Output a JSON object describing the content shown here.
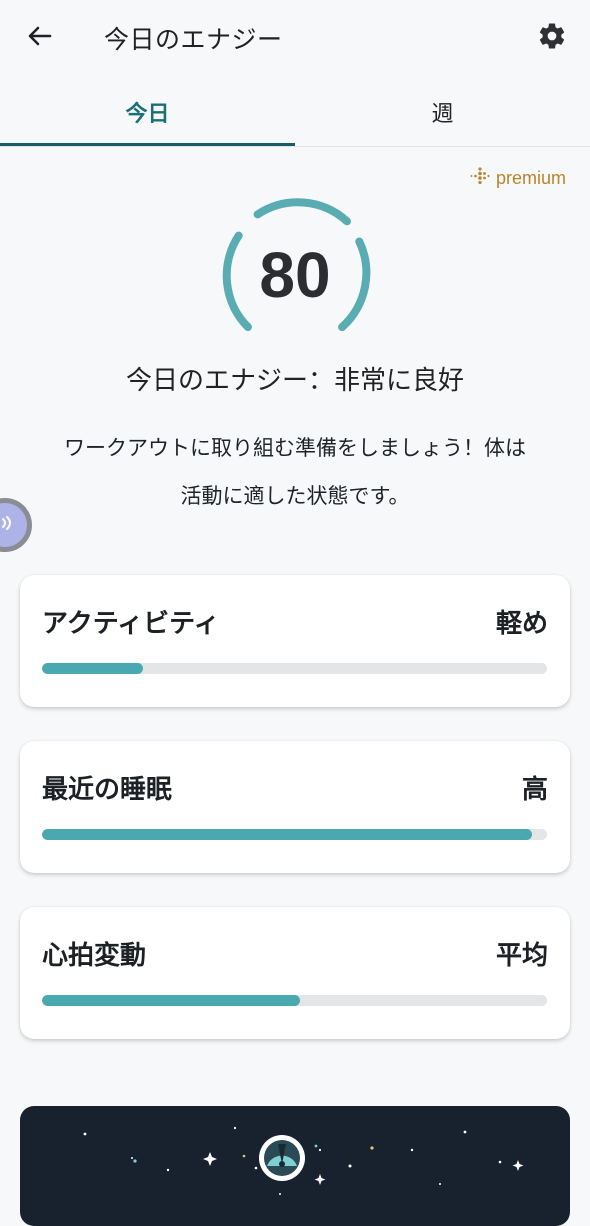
{
  "header": {
    "title": "今日のエナジー",
    "back_icon": "arrow-left-icon",
    "settings_icon": "gear-icon"
  },
  "tabs": [
    {
      "label": "今日",
      "active": true
    },
    {
      "label": "週",
      "active": false
    }
  ],
  "premium": {
    "label": "premium",
    "icon": "fitbit-dots-icon",
    "color": "#b7862a"
  },
  "energy": {
    "score": "80",
    "headline": "今日のエナジー：非常に良好",
    "description": "ワークアウトに取り組む準備をしましょう！体は活動に適した状態です。",
    "gauge_color": "#5aacb3"
  },
  "metrics": [
    {
      "label": "アクティビティ",
      "value": "軽め",
      "level": 0.2
    },
    {
      "label": "最近の睡眠",
      "value": "高",
      "level": 0.97
    },
    {
      "label": "心拍変動",
      "value": "平均",
      "level": 0.51
    }
  ],
  "colors": {
    "accent": "#1a6f78",
    "bar_fill": "#4aa8b1",
    "promo_bg": "#17222e"
  }
}
